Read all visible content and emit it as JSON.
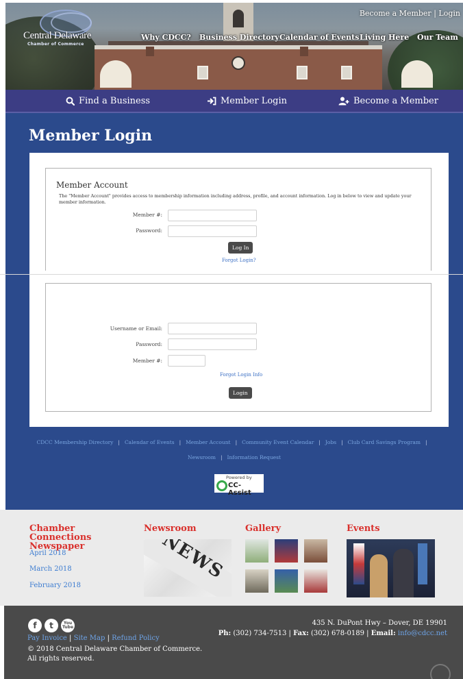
{
  "header": {
    "logo_main": "Central Delaware",
    "logo_sub": "Chamber of Commerce",
    "top_links": {
      "become_member": "Become a Member",
      "separator": "|",
      "login": "Login"
    },
    "nav": [
      "Why CDCC?",
      "Business Directory",
      "Calendar of Events",
      "Living Here",
      "Our Team"
    ]
  },
  "action_bar": {
    "find_business": "Find a Business",
    "member_login": "Member Login",
    "become_member": "Become a Member"
  },
  "page_title": "Member Login",
  "member_account": {
    "title": "Member Account",
    "description": "The \"Member Account\" provides access to membership information including address, profile, and account information. Log in below to view and update your member information.",
    "member_label": "Member #:",
    "password_label": "Password:",
    "login_button": "Log In",
    "forgot_link": "Forgot Login?"
  },
  "login_form": {
    "username_label": "Username or Email:",
    "password_label": "Password:",
    "member_label": "Member #:",
    "forgot_link": "Forgot Login Info",
    "login_button": "Login"
  },
  "footer_links": {
    "row1": [
      "CDCC Membership Directory",
      "Calendar of Events",
      "Member Account",
      "Community Event Calendar",
      "Jobs",
      "Club Card Savings Program"
    ],
    "row2": [
      "Newsroom",
      "Information Request"
    ],
    "separator": "|"
  },
  "powered_by": {
    "label": "Powered by",
    "brand": "CC-Assist"
  },
  "columns": {
    "newspaper_title": "Chamber Connections Newspaper",
    "newspaper_items": [
      "April 2018",
      "March 2018",
      "February 2018"
    ],
    "newsroom_title": "Newsroom",
    "newsroom_image_text": "NEWS",
    "gallery_title": "Gallery",
    "events_title": "Events"
  },
  "footer": {
    "social": [
      "f",
      "t",
      "You Tube"
    ],
    "links": [
      "Pay Invoice",
      "Site Map",
      "Refund Policy"
    ],
    "link_separator": "|",
    "copyright": "© 2018 Central Delaware Chamber of Commerce. All rights reserved.",
    "address": "435 N. DuPont Hwy – Dover, DE 19901",
    "phone_label": "Ph:",
    "phone": "(302) 734-7513",
    "fax_label": "Fax:",
    "fax": "(302) 678-0189",
    "email_label": "Email:",
    "email": "info@cdcc.net",
    "contact_separator": "|"
  },
  "colors": {
    "action_bar": "#3c3d84",
    "main_blue": "#2b4a8c",
    "accent_red": "#d9302c",
    "link_blue": "#3b7bd0",
    "footer_dark": "#4a4a4a"
  }
}
